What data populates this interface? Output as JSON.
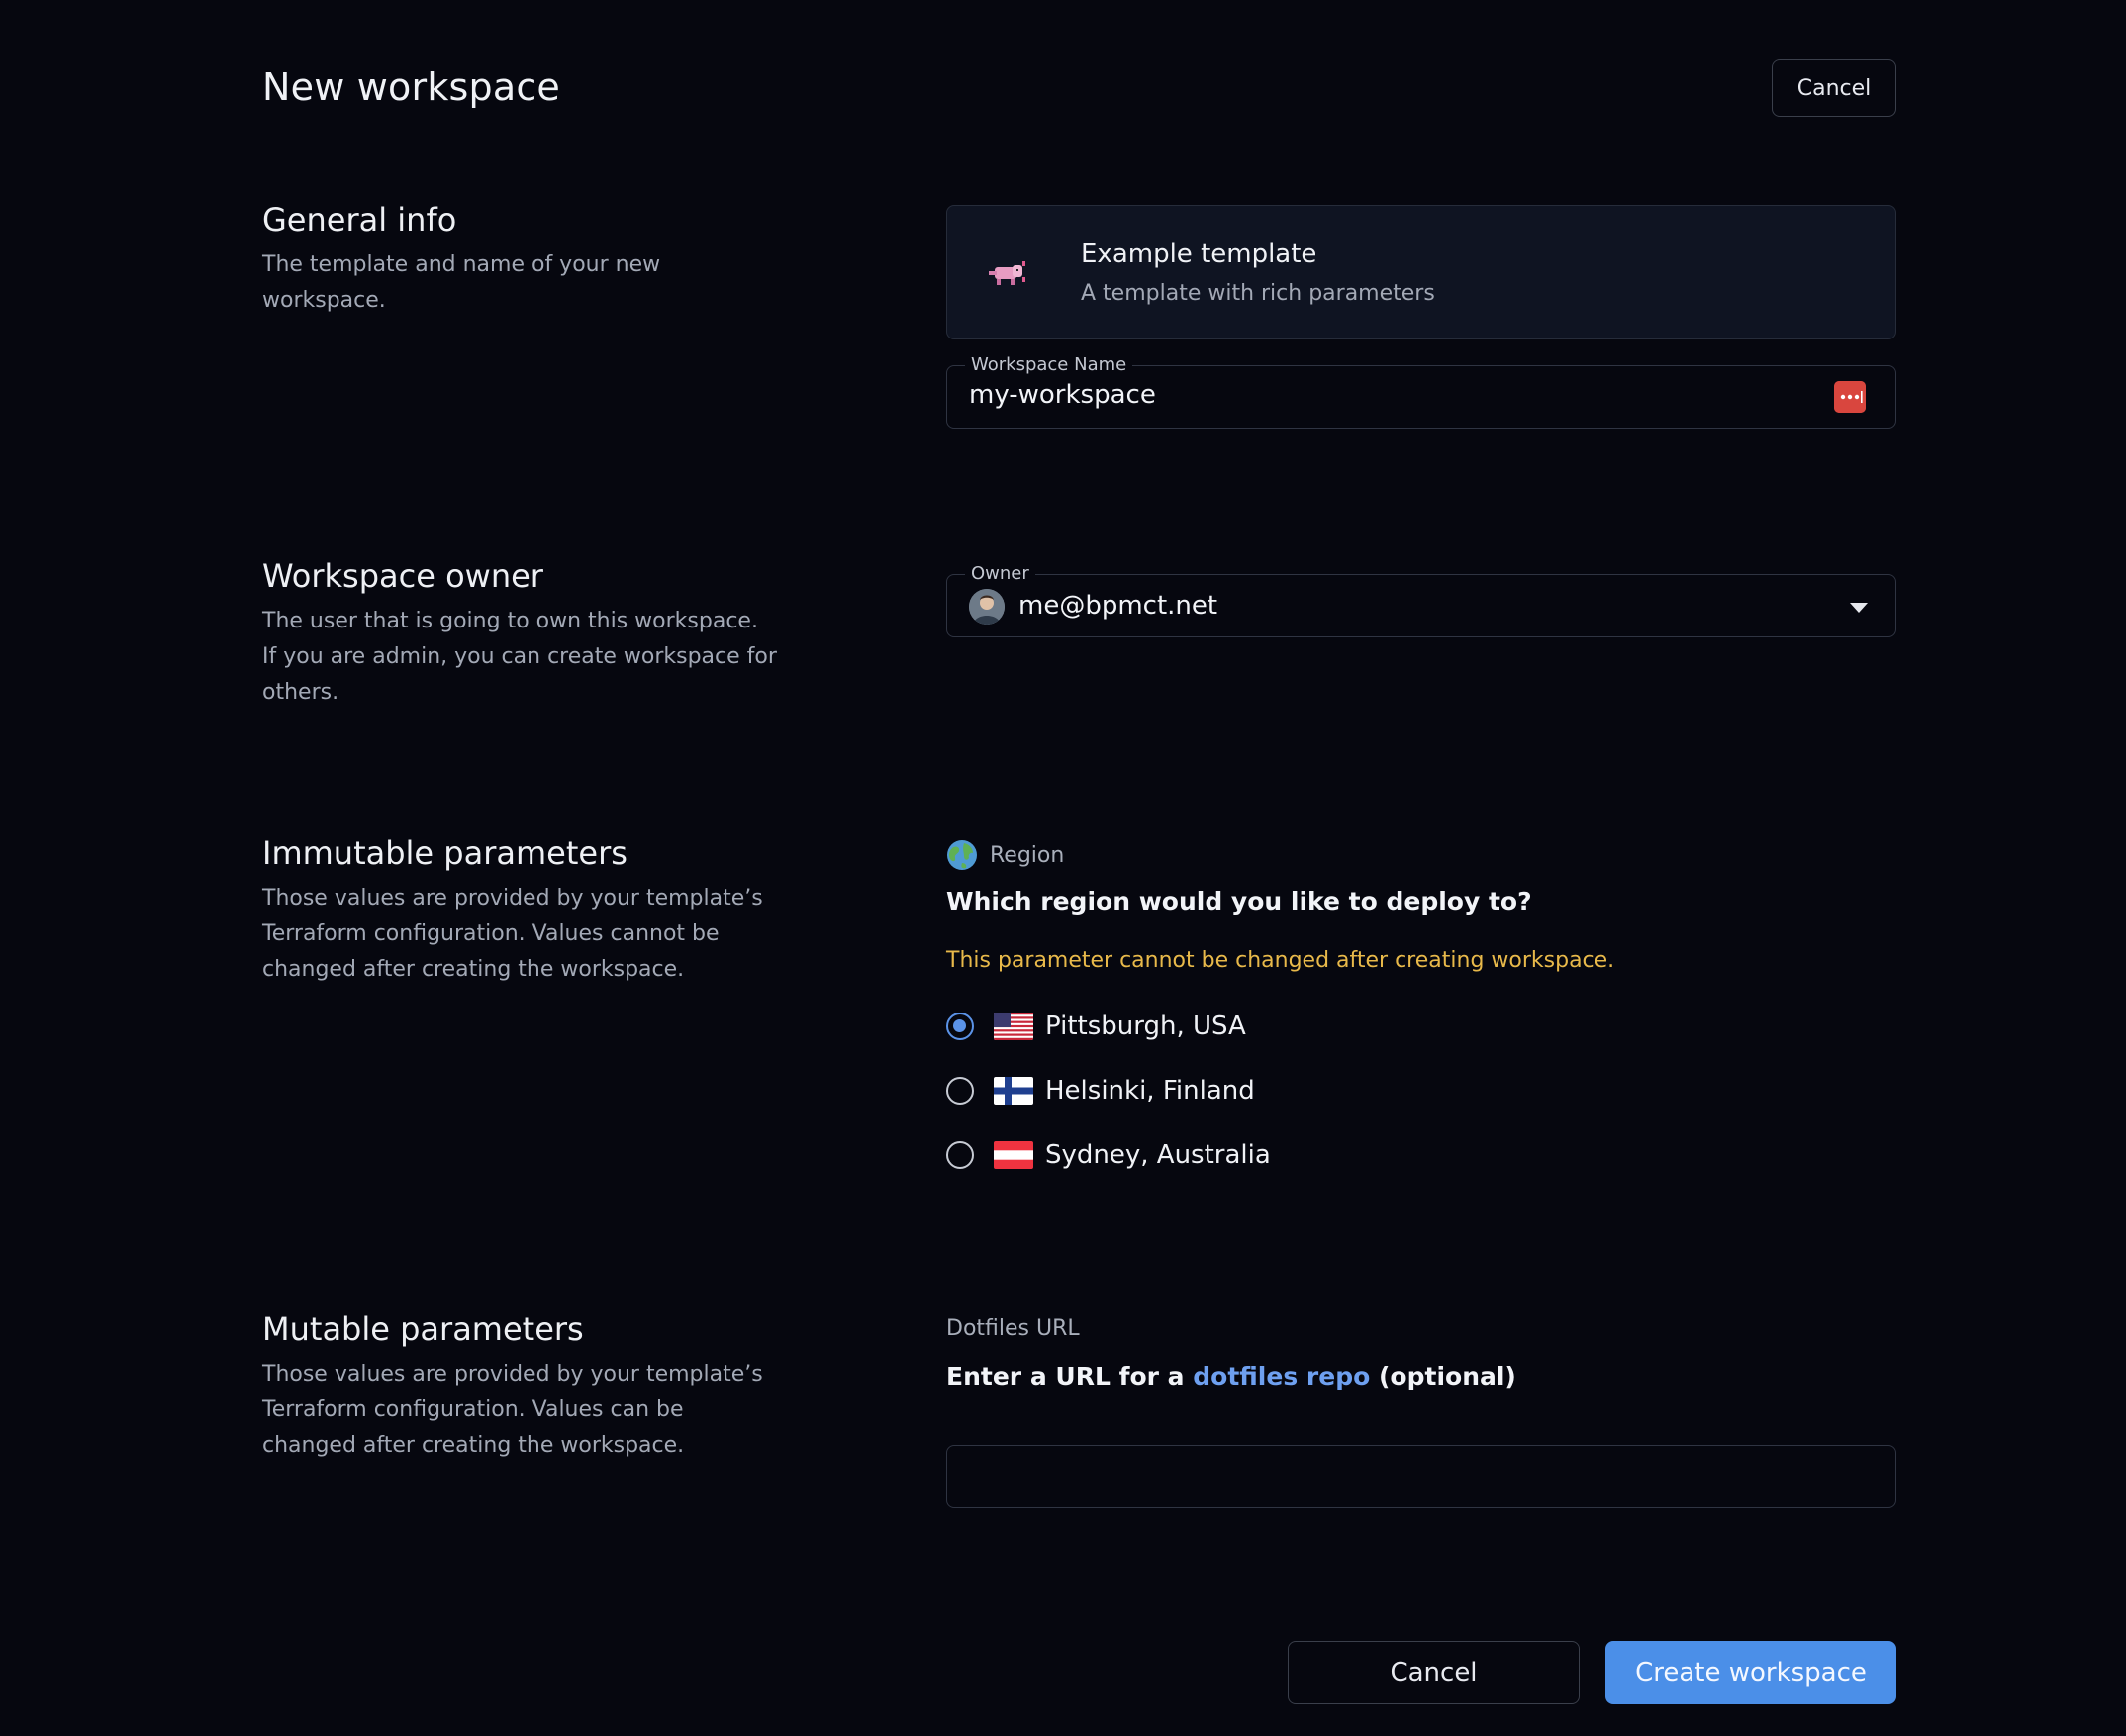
{
  "header": {
    "title": "New workspace",
    "cancel_label": "Cancel"
  },
  "sections": {
    "general": {
      "title": "General info",
      "description": "The template and name of your new workspace."
    },
    "owner": {
      "title": "Workspace owner",
      "description": "The user that is going to own this workspace. If you are admin, you can create workspace for others."
    },
    "immutable": {
      "title": "Immutable parameters",
      "description": "Those values are provided by your template’s Terraform configuration. Values cannot be changed after creating the workspace."
    },
    "mutable": {
      "title": "Mutable parameters",
      "description": "Those values are provided by your template’s Terraform configuration. Values can be changed after creating the workspace."
    }
  },
  "template": {
    "name": "Example template",
    "description": "A template with rich parameters",
    "icon": "axolotl-icon"
  },
  "workspace_name": {
    "label": "Workspace Name",
    "value": "my-workspace"
  },
  "owner_field": {
    "label": "Owner",
    "value": "me@bpmct.net"
  },
  "region_param": {
    "label": "Region",
    "question": "Which region would you like to deploy to?",
    "warning": "This parameter cannot be changed after creating workspace.",
    "options": [
      {
        "label": "Pittsburgh, USA",
        "flag": "us-flag",
        "checked": true
      },
      {
        "label": "Helsinki, Finland",
        "flag": "fi-flag",
        "checked": false
      },
      {
        "label": "Sydney, Australia",
        "flag": "au-flag",
        "checked": false
      }
    ]
  },
  "dotfiles_param": {
    "label": "Dotfiles URL",
    "question_prefix": "Enter a URL for a",
    "question_link": "dotfiles repo",
    "question_suffix": "(optional)",
    "value": ""
  },
  "footer": {
    "cancel_label": "Cancel",
    "create_label": "Create workspace"
  },
  "colors": {
    "accent": "#4b8fe8",
    "warning": "#e8b94a",
    "background": "#06070f"
  }
}
